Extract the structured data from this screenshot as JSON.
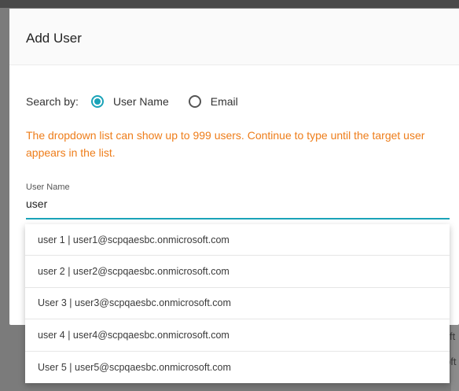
{
  "dialog": {
    "title": "Add User"
  },
  "search_by": {
    "label": "Search by:",
    "options": [
      {
        "label": "User Name",
        "selected": true
      },
      {
        "label": "Email",
        "selected": false
      }
    ]
  },
  "warning": "The dropdown list can show up to 999 users. Continue to type until the target user appears in the list.",
  "username_field": {
    "label": "User Name",
    "value": "user"
  },
  "dropdown": {
    "items": [
      "user 1 | user1@scpqaesbc.onmicrosoft.com",
      "user 2 | user2@scpqaesbc.onmicrosoft.com",
      "User 3 | user3@scpqaesbc.onmicrosoft.com",
      "user 4 | user4@scpqaesbc.onmicrosoft.com",
      "User 5 | user5@scpqaesbc.onmicrosoft.com"
    ]
  },
  "background": {
    "partial_text_1": "ft",
    "partial_text_2": "oft"
  },
  "colors": {
    "accent": "#1aa3b8",
    "warning": "#ee7d1a"
  }
}
